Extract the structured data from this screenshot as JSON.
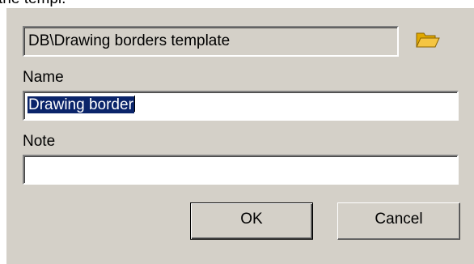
{
  "caption_fragment": "the templ.",
  "template": {
    "path": "DB\\Drawing borders template",
    "browse_icon": "folder-open-icon",
    "browse_icon_color": "#f5c542"
  },
  "name": {
    "label": "Name",
    "value": "Drawing border",
    "selected": true
  },
  "note": {
    "label": "Note",
    "value": ""
  },
  "buttons": {
    "ok_label": "OK",
    "cancel_label": "Cancel"
  },
  "colors": {
    "dialog_background": "#d4d0c8",
    "selection_background": "#0a246a",
    "selection_text": "#ffffff"
  }
}
